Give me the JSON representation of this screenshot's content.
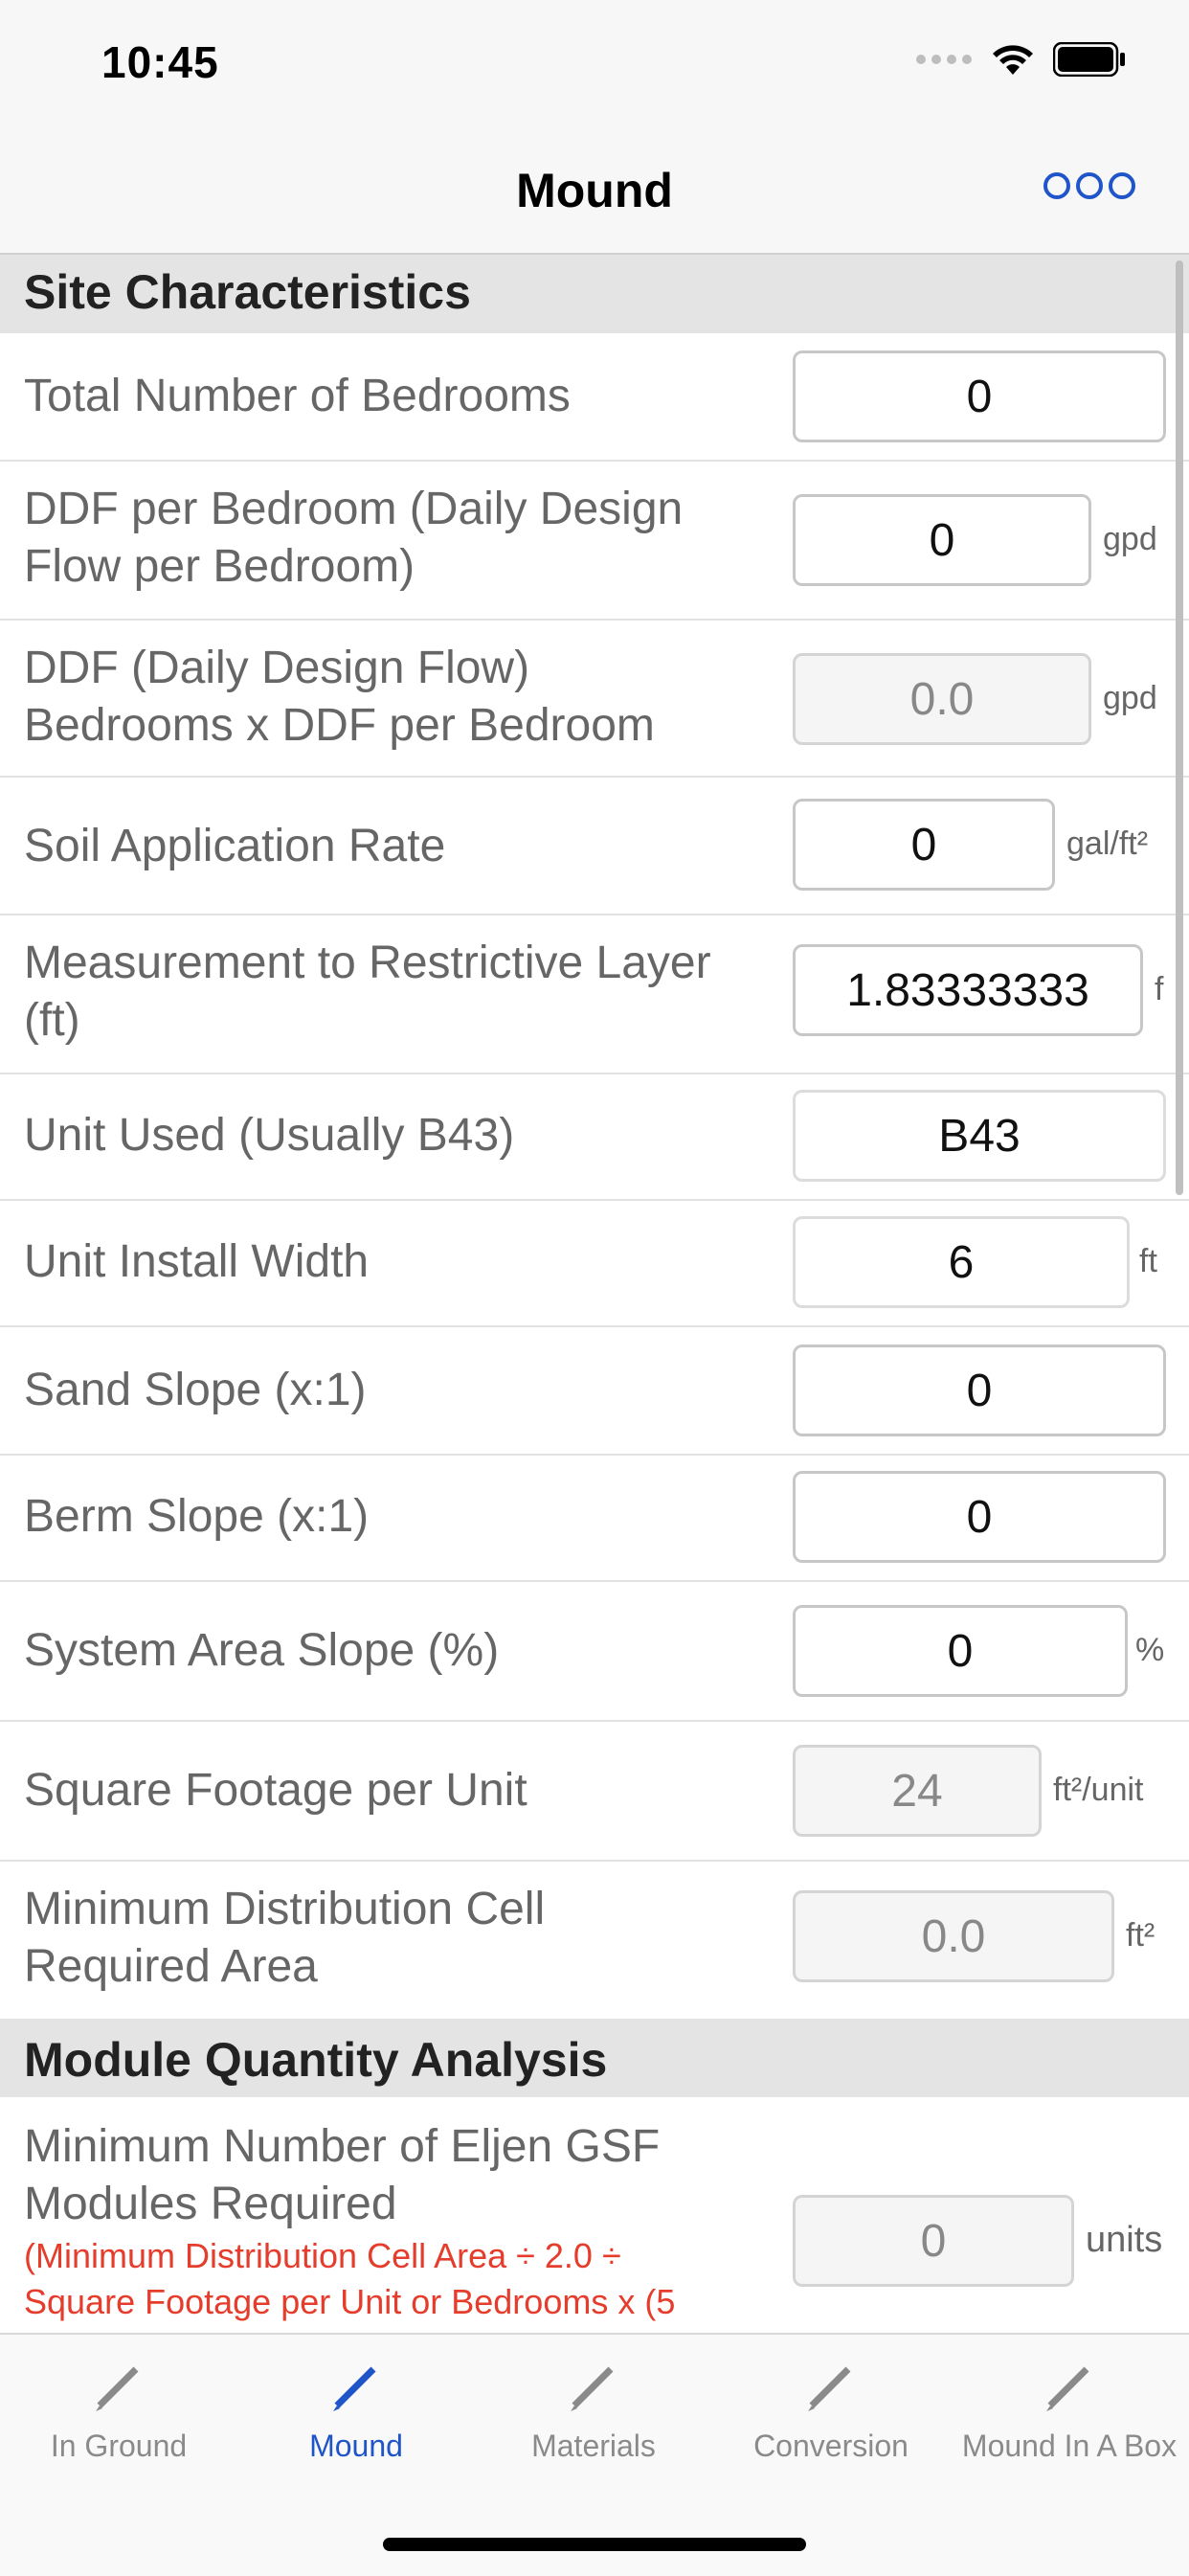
{
  "status_bar": {
    "time": "10:45"
  },
  "nav": {
    "title": "Mound"
  },
  "sections": {
    "site": "Site Characteristics",
    "module": "Module Quantity Analysis"
  },
  "fields": {
    "bedrooms": {
      "label": "Total Number of Bedrooms",
      "value": "0"
    },
    "ddf_per_bedroom": {
      "label_1": "DDF per Bedroom (Daily Design",
      "label_2": "Flow per Bedroom)",
      "value": "0",
      "unit": "gpd"
    },
    "ddf": {
      "label_1": "DDF (Daily Design Flow)",
      "label_2": "Bedrooms x DDF per Bedroom",
      "value": "0.0",
      "unit": "gpd"
    },
    "soil_rate": {
      "label": "Soil Application Rate",
      "value": "0",
      "unit": "gal/ft²"
    },
    "restrictive_layer": {
      "label_1": "Measurement to Restrictive Layer",
      "label_2": "(ft)",
      "value": "1.83333333",
      "unit": "f"
    },
    "unit_used": {
      "label": "Unit Used (Usually B43)",
      "value": "B43"
    },
    "install_width": {
      "label": "Unit Install Width",
      "value": "6",
      "unit": "ft"
    },
    "sand_slope": {
      "label": "Sand Slope (x:1)",
      "value": "0"
    },
    "berm_slope": {
      "label": "Berm Slope (x:1)",
      "value": "0"
    },
    "area_slope": {
      "label": "System Area Slope (%)",
      "value": "0",
      "unit": "%"
    },
    "sqft_per_unit": {
      "label": "Square Footage per Unit",
      "value": "24",
      "unit": "ft²/unit"
    },
    "min_cell_area": {
      "label_1": "Minimum Distribution Cell",
      "label_2": "Required Area",
      "value": "0.0",
      "unit": "ft²"
    },
    "min_modules": {
      "label_1": "Minimum Number of Eljen GSF",
      "label_2": "Modules Required",
      "note_1": "(Minimum Distribution Cell Area ÷ 2.0 ÷",
      "note_2": "Square Footage per Unit or Bedrooms x  (5",
      "value": "0",
      "unit": "units"
    }
  },
  "tabs": [
    {
      "label": "In Ground",
      "icon": "pencil-icon"
    },
    {
      "label": "Mound",
      "icon": "pencil-icon"
    },
    {
      "label": "Materials",
      "icon": "pencil-icon"
    },
    {
      "label": "Conversion",
      "icon": "pencil-icon"
    },
    {
      "label": "Mound In A Box",
      "icon": "pencil-icon"
    }
  ],
  "colors": {
    "accent": "#1f55c9",
    "note_red": "#e53c2c"
  }
}
